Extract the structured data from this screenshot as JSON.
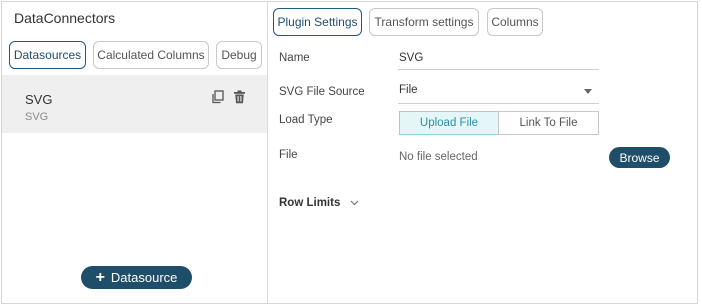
{
  "left_panel": {
    "title": "DataConnectors",
    "tabs": [
      {
        "label": "Datasources"
      },
      {
        "label": "Calculated Columns"
      },
      {
        "label": "Debug"
      }
    ],
    "datasource": {
      "name": "SVG",
      "type": "SVG"
    },
    "add_button": "Datasource"
  },
  "right_panel": {
    "tabs": [
      {
        "label": "Plugin Settings"
      },
      {
        "label": "Transform settings"
      },
      {
        "label": "Columns"
      }
    ],
    "fields": {
      "name_label": "Name",
      "name_value": "SVG",
      "source_label": "SVG File Source",
      "source_value": "File",
      "load_type_label": "Load Type",
      "load_options": [
        "Upload File",
        "Link To File"
      ],
      "file_label": "File",
      "file_value": "No file selected",
      "browse_label": "Browse"
    },
    "row_limits_label": "Row Limits"
  },
  "colors": {
    "primary": "#1f4e6b",
    "toggle_active_bg": "#e4f6f8",
    "toggle_active_text": "#2a8fa6",
    "selected_row_bg": "#efefef"
  },
  "icons": [
    "copy-icon",
    "trash-icon",
    "plus-icon",
    "caret-down-icon",
    "chevron-down-icon"
  ]
}
